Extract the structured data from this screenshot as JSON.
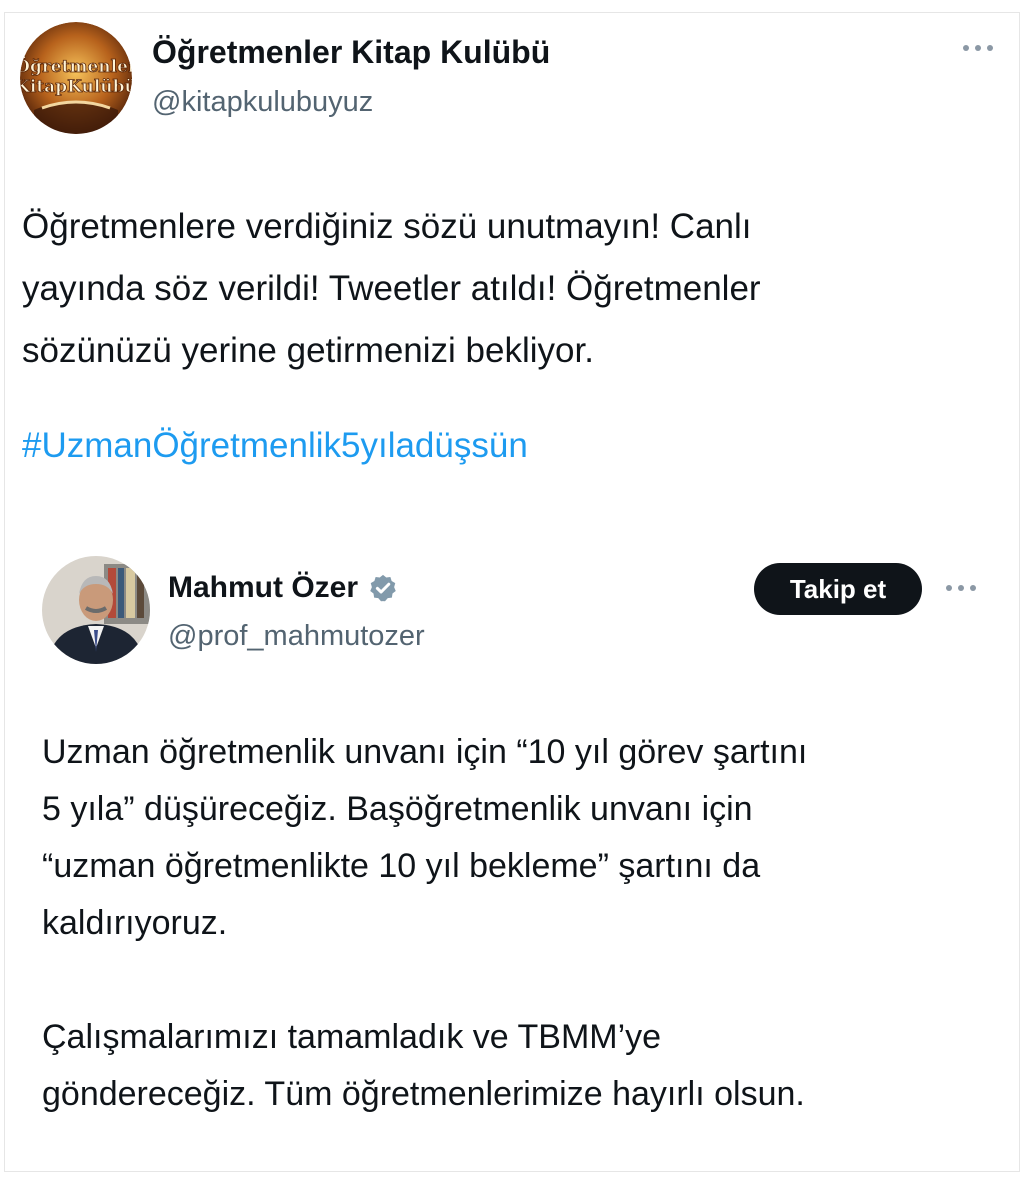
{
  "main_tweet": {
    "author_name": "Öğretmenler Kitap Kulübü",
    "author_handle": "@kitapkulubuyuz",
    "avatar_logo_text": "Öğretmenler Kitap Kulübü",
    "more_icon": "more-horizontal-icon",
    "text_lines": [
      "Öğretmenlere verdiğiniz sözü unutmayın! Canlı",
      "yayında söz verildi! Tweetler atıldı! Öğretmenler",
      "sözünüzü yerine getirmenizi bekliyor."
    ],
    "hashtag": "#UzmanÖğretmenlik5yıladüşsün"
  },
  "quoted_tweet": {
    "author_name": "Mahmut Özer",
    "verified_icon": "verified-badge-icon",
    "author_handle": "@prof_mahmutozer",
    "follow_label": "Takip et",
    "more_icon": "more-horizontal-icon",
    "paragraph_1": [
      "Uzman öğretmenlik unvanı için “10 yıl görev şartını",
      "5 yıla” düşüreceğiz. Başöğretmenlik unvanı için",
      "“uzman öğretmenlikte 10 yıl bekleme” şartını da",
      "kaldırıyoruz."
    ],
    "paragraph_2": [
      "Çalışmalarımızı tamamladık ve TBMM’ye",
      "göndereceğiz. Tüm öğretmenlerimize hayırlı olsun."
    ]
  },
  "colors": {
    "text": "#0f1419",
    "secondary": "#536471",
    "link": "#1d9bf0",
    "button_bg": "#0f1419"
  }
}
